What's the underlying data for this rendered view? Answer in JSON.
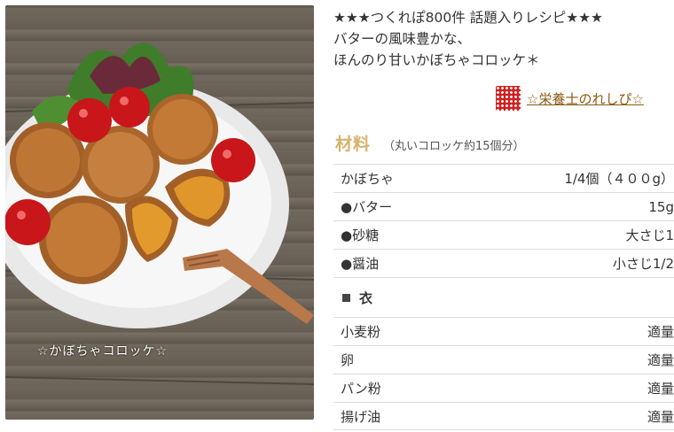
{
  "photo": {
    "caption": "☆かぼちゃコロッケ☆"
  },
  "header": {
    "catch_lines": [
      "★★★つくれぽ800件 話題入りレシピ★★★",
      "バターの風味豊かな、",
      "ほんのり甘いかぼちゃコロッケ＊"
    ],
    "author_name": "☆栄養士のれしぴ☆"
  },
  "ingredients": {
    "title": "材料",
    "serving": "（丸いコロッケ約15個分）",
    "items": [
      {
        "name": "かぼちゃ",
        "amount": "1/4個（４００g）"
      },
      {
        "name": "●バター",
        "amount": "15g"
      },
      {
        "name": "●砂糖",
        "amount": "大さじ1"
      },
      {
        "name": "●醤油",
        "amount": "小さじ1/2"
      }
    ],
    "group_label": "衣",
    "group_items": [
      {
        "name": "小麦粉",
        "amount": "適量"
      },
      {
        "name": "卵",
        "amount": "適量"
      },
      {
        "name": "パン粉",
        "amount": "適量"
      },
      {
        "name": "揚げ油",
        "amount": "適量"
      }
    ]
  },
  "colors": {
    "accent_title": "#d6b26a",
    "author_link": "#8a5a10",
    "author_icon": "#d32020"
  }
}
